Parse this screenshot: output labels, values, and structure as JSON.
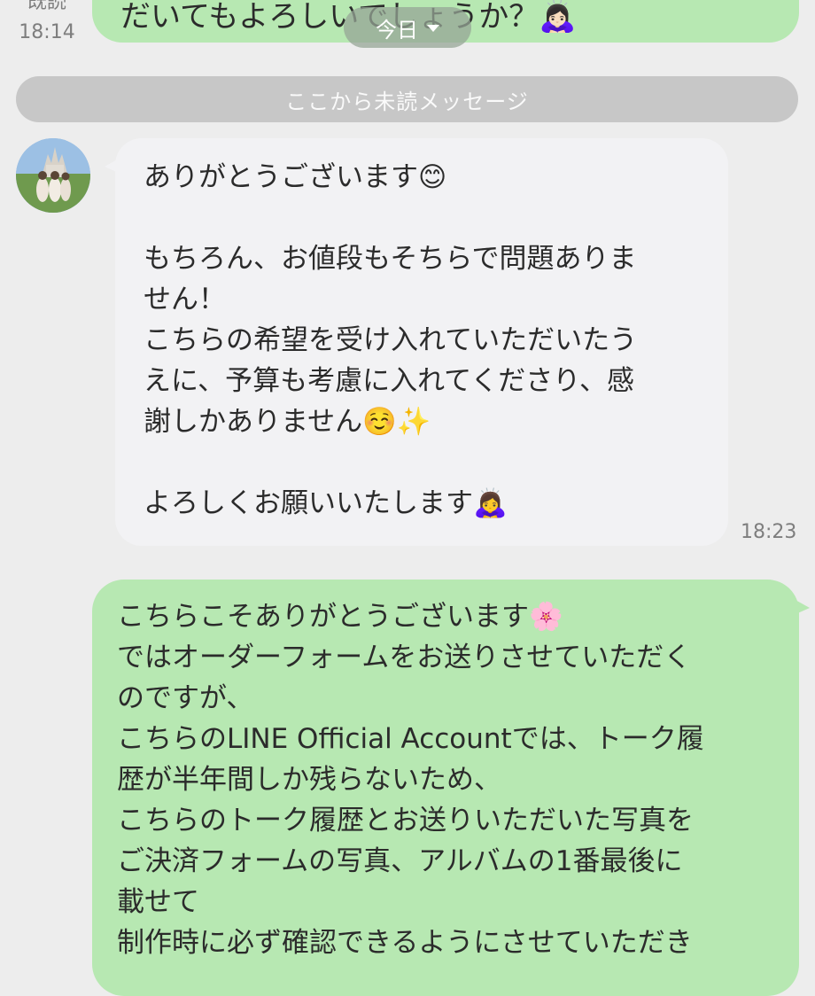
{
  "top": {
    "status": "既読",
    "time": "18:14",
    "partial_text": "だいてもよろしいでしょうか？🙇🏻‍♀️"
  },
  "date_pill": {
    "label": "今日"
  },
  "unread_divider": {
    "label": "ここから未読メッセージ"
  },
  "incoming": {
    "time": "18:23",
    "lines": [
      "ありがとうございます😊",
      "",
      "もちろん、お値段もそちらで問題ありま",
      "せん！",
      "こちらの希望を受け入れていただいたう",
      "えに、予算も考慮に入れてくださり、感",
      "謝しかありません☺️✨",
      "",
      "よろしくお願いいたします🙇‍♀️"
    ]
  },
  "outgoing": {
    "lines": [
      "こちらこそありがとうございます🌸",
      "ではオーダーフォームをお送りさせていただく",
      "のですが、",
      "こちらのLINE Official Accountでは、トーク履",
      "歴が半年間しか残らないため、",
      "こちらのトーク履歴とお送りいただいた写真を",
      "ご決済フォームの写真、アルバムの1番最後に",
      "載せて",
      "制作時に必ず確認できるようにさせていただき"
    ]
  },
  "colors": {
    "outgoing_bubble": "#b7e8b2",
    "incoming_bubble": "#f2f2f4",
    "background": "#ededed"
  },
  "icons": {
    "date_caret": "caret-down-icon"
  }
}
